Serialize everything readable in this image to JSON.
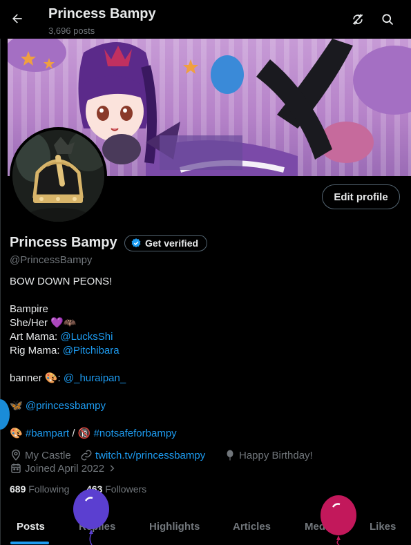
{
  "header": {
    "title": "Princess Bampy",
    "posts_count": "3,696 posts"
  },
  "profile": {
    "name": "Princess Bampy",
    "verify_label": "Get verified",
    "handle": "@PrincessBampy",
    "edit_label": "Edit profile"
  },
  "bio": {
    "line1": "BOW DOWN PEONS!",
    "line2": "Bampire",
    "line3_text": "She/Her 💜🦇",
    "line4_prefix": "Art Mama: ",
    "line4_link": "@LucksShi",
    "line5_prefix": "Rig Mama: ",
    "line5_link": "@Pitchibara",
    "line6_prefix": "banner 🎨: ",
    "line6_link": "@_huraipan_",
    "line7_prefix": "🦋 ",
    "line7_link": "@princessbampy",
    "line8_prefix": "🎨 ",
    "line8_link1": "#bampart",
    "line8_sep": " / 🔞 ",
    "line8_link2": "#notsafeforbampy"
  },
  "meta": {
    "location": "My Castle",
    "website": "twitch.tv/princessbampy",
    "birthday": "Happy Birthday!",
    "joined": "Joined April 2022"
  },
  "stats": {
    "following_count": "689",
    "following_label": "Following",
    "followers_count": "463",
    "followers_label": "Followers"
  },
  "tabs": [
    "Posts",
    "Replies",
    "Highlights",
    "Articles",
    "Media",
    "Likes"
  ],
  "colors": {
    "accent": "#1d9bf0",
    "muted": "#71767b",
    "text": "#e7e9ea",
    "balloon_purple": "#5b3fd0",
    "balloon_magenta": "#c2185b"
  },
  "icons": [
    "back-arrow-icon",
    "sync-icon",
    "search-icon",
    "verified-badge-icon",
    "location-icon",
    "link-icon",
    "balloon-icon",
    "calendar-icon",
    "chevron-right-icon"
  ]
}
